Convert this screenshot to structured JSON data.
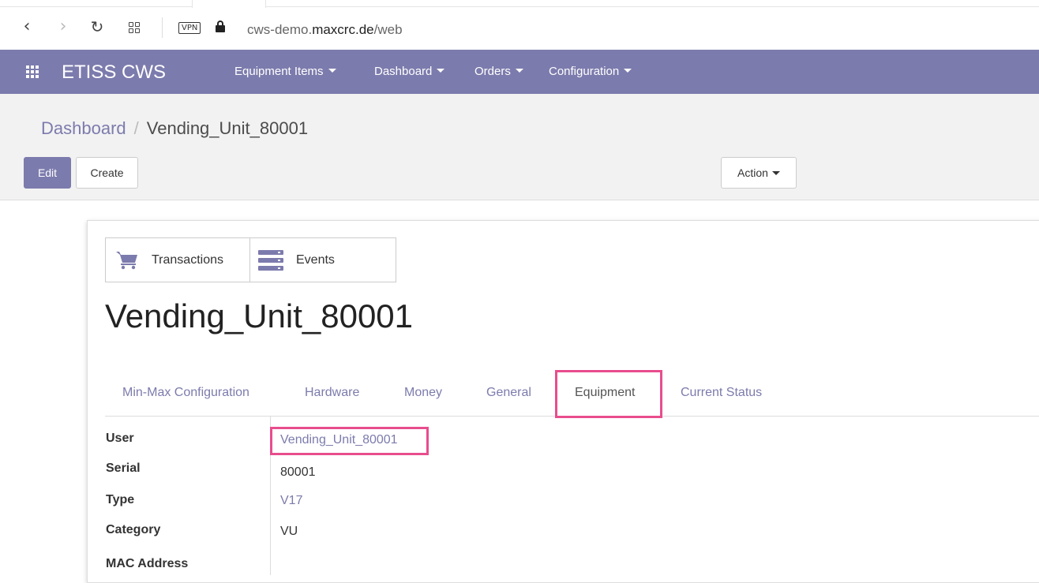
{
  "browser": {
    "url_prefix": "cws-demo.",
    "url_host": "maxcrc.de",
    "url_path": "/web",
    "vpn_label": "VPN"
  },
  "navbar": {
    "brand": "ETISS CWS",
    "menus": [
      "Equipment Items",
      "Dashboard",
      "Orders",
      "Configuration"
    ],
    "color": "#7c7bad"
  },
  "breadcrumb": {
    "parent": "Dashboard",
    "separator": "/",
    "current": "Vending_Unit_80001"
  },
  "buttons": {
    "edit": "Edit",
    "create": "Create",
    "action": "Action"
  },
  "stat_buttons": {
    "transactions": "Transactions",
    "events": "Events"
  },
  "record_title": "Vending_Unit_80001",
  "tabs": [
    "Min-Max Configuration",
    "Hardware",
    "Money",
    "General",
    "Equipment",
    "Current Status"
  ],
  "active_tab": "Equipment",
  "fields": {
    "user_label": "User",
    "user_value": "Vending_Unit_80001",
    "serial_label": "Serial",
    "serial_value": "80001",
    "type_label": "Type",
    "type_value": "V17",
    "category_label": "Category",
    "category_value": "VU",
    "mac_label": "MAC Address"
  },
  "highlight_color": "#e84d8d"
}
